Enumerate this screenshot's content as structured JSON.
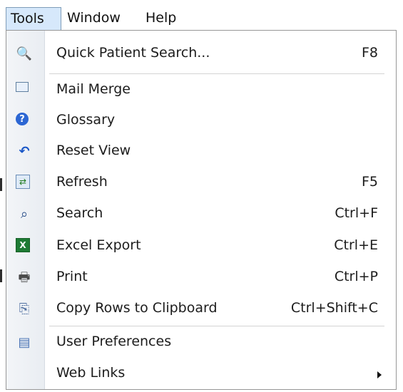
{
  "menubar": {
    "tools_label": "Tools",
    "window_label": "Window",
    "help_label": "Help"
  },
  "menu": {
    "items": [
      {
        "icon": "search-icon",
        "label": "Quick Patient Search...",
        "shortcut": "F8"
      },
      {
        "icon": "mail-merge-icon",
        "label": "Mail Merge",
        "shortcut": ""
      },
      {
        "icon": "help-circle-icon",
        "label": "Glossary",
        "shortcut": ""
      },
      {
        "icon": "undo-icon",
        "label": "Reset View",
        "shortcut": ""
      },
      {
        "icon": "refresh-icon",
        "label": "Refresh",
        "shortcut": "F5"
      },
      {
        "icon": "binoculars-icon",
        "label": "Search",
        "shortcut": "Ctrl+F"
      },
      {
        "icon": "excel-icon",
        "label": "Excel Export",
        "shortcut": "Ctrl+E"
      },
      {
        "icon": "printer-icon",
        "label": "Print",
        "shortcut": "Ctrl+P"
      },
      {
        "icon": "copy-icon",
        "label": "Copy Rows to Clipboard",
        "shortcut": "Ctrl+Shift+C"
      },
      {
        "icon": "preferences-icon",
        "label": "User Preferences",
        "shortcut": ""
      },
      {
        "icon": "",
        "label": "Web Links",
        "shortcut": ""
      }
    ]
  }
}
